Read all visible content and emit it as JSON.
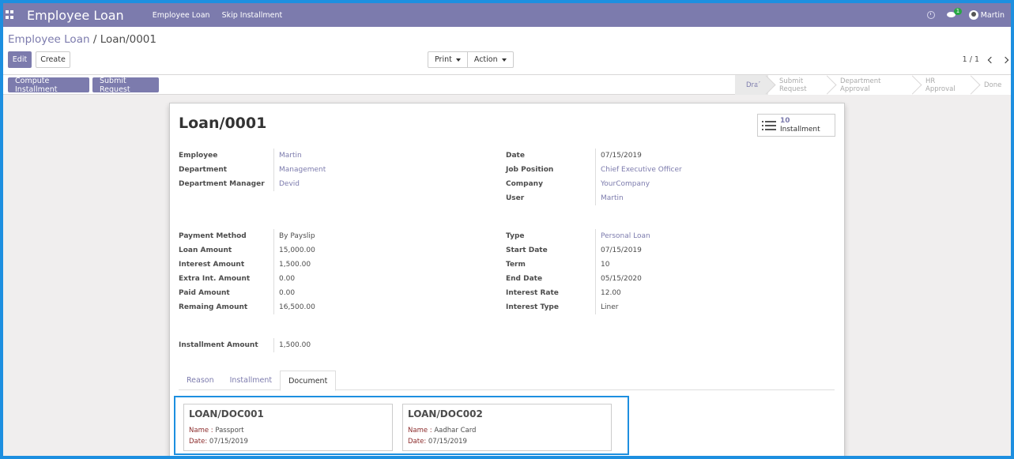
{
  "navbar": {
    "app_title": "Employee Loan",
    "menu": [
      "Employee Loan",
      "Skip Installment"
    ],
    "chat_badge": "1",
    "user_name": "Martin"
  },
  "breadcrumb": {
    "parent": "Employee Loan",
    "separator": "/",
    "current": "Loan/0001"
  },
  "buttons": {
    "edit": "Edit",
    "create": "Create",
    "print": "Print",
    "action": "Action"
  },
  "pager": {
    "value": "1 / 1"
  },
  "statusbar": {
    "compute": "Compute Installment",
    "submit": "Submit Request",
    "stages": [
      "Draft",
      "Submit Request",
      "Department Approval",
      "HR Approval",
      "Done"
    ],
    "active_stage": "Draft"
  },
  "record": {
    "title": "Loan/0001",
    "smart_button": {
      "count": "10",
      "label": "Installment"
    },
    "left_group_1": [
      {
        "label": "Employee",
        "value": "Martin",
        "link": true
      },
      {
        "label": "Department",
        "value": "Management",
        "link": true
      },
      {
        "label": "Department Manager",
        "value": "Devid",
        "link": true
      }
    ],
    "right_group_1": [
      {
        "label": "Date",
        "value": "07/15/2019",
        "link": false
      },
      {
        "label": "Job Position",
        "value": "Chief Executive Officer",
        "link": true
      },
      {
        "label": "Company",
        "value": "YourCompany",
        "link": true
      },
      {
        "label": "User",
        "value": "Martin",
        "link": true
      }
    ],
    "left_group_2": [
      {
        "label": "Payment Method",
        "value": "By Payslip",
        "link": false
      },
      {
        "label": "Loan Amount",
        "value": "15,000.00",
        "link": false
      },
      {
        "label": "Interest Amount",
        "value": "1,500.00",
        "link": false
      },
      {
        "label": "Extra Int. Amount",
        "value": "0.00",
        "link": false
      },
      {
        "label": "Paid Amount",
        "value": "0.00",
        "link": false
      },
      {
        "label": "Remaing Amount",
        "value": "16,500.00",
        "link": false
      }
    ],
    "right_group_2": [
      {
        "label": "Type",
        "value": "Personal Loan",
        "link": true
      },
      {
        "label": "Start Date",
        "value": "07/15/2019",
        "link": false
      },
      {
        "label": "Term",
        "value": "10",
        "link": false
      },
      {
        "label": "End Date",
        "value": "05/15/2020",
        "link": false
      },
      {
        "label": "Interest Rate",
        "value": "12.00",
        "link": false
      },
      {
        "label": "Interest Type",
        "value": "Liner",
        "link": false
      }
    ],
    "installment_amount": {
      "label": "Installment Amount",
      "value": "1,500.00"
    }
  },
  "tabs": [
    "Reason",
    "Installment",
    "Document"
  ],
  "active_tab": "Document",
  "documents": [
    {
      "title": "LOAN/DOC001",
      "name_key": "Name :",
      "name": "Passport",
      "date_key": "Date:",
      "date": "07/15/2019"
    },
    {
      "title": "LOAN/DOC002",
      "name_key": "Name :",
      "name": "Aadhar Card",
      "date_key": "Date:",
      "date": "07/15/2019"
    }
  ],
  "colors": {
    "brand": "#7c7bad",
    "highlight_border": "#1d8fe0",
    "doc_key": "#8b2a2a"
  }
}
